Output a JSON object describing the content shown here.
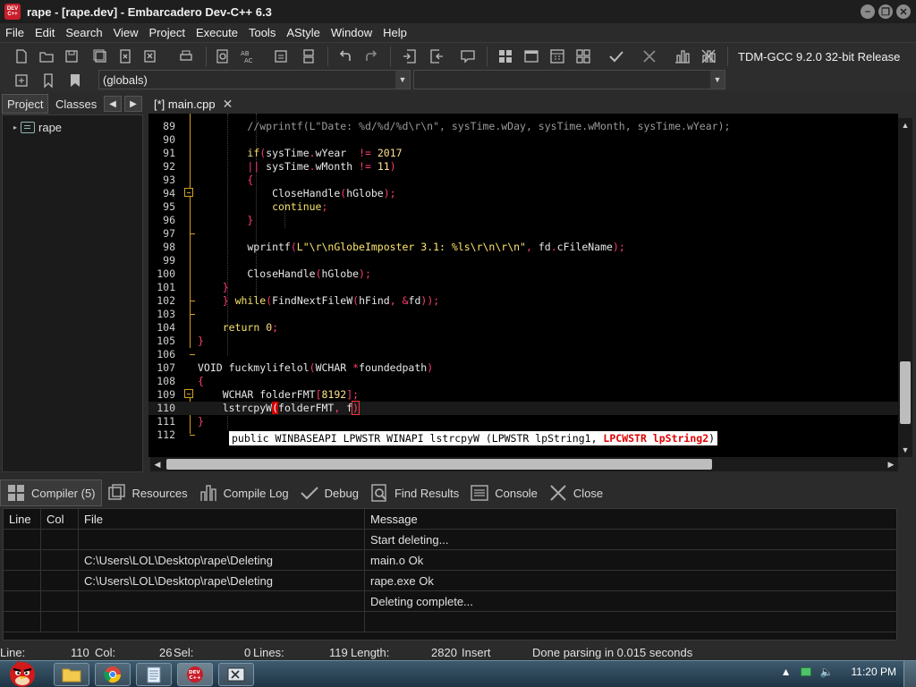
{
  "window": {
    "title": "rape - [rape.dev] - Embarcadero Dev-C++ 6.3",
    "app_icon_text": "DEV C++",
    "controls": [
      "–",
      "❐",
      "✕"
    ]
  },
  "menu": [
    "File",
    "Edit",
    "Search",
    "View",
    "Project",
    "Execute",
    "Tools",
    "AStyle",
    "Window",
    "Help"
  ],
  "toolbar": {
    "compiler": "TDM-GCC 9.2.0 32-bit Release",
    "scope_combo": "(globals)",
    "symbol_combo": ""
  },
  "left_panel": {
    "tabs": [
      "Project",
      "Classes"
    ],
    "nav_prev": "◀",
    "nav_next": "▶",
    "tree": {
      "expander": "▸",
      "project_name": "rape"
    }
  },
  "editor": {
    "tab_label": "[*] main.cpp",
    "tab_close": "✕",
    "line_numbers": [
      "89",
      "90",
      "91",
      "92",
      "93",
      "94",
      "95",
      "96",
      "97",
      "98",
      "99",
      "100",
      "101",
      "102",
      "103",
      "104",
      "105",
      "106",
      "107",
      "108",
      "109",
      "110",
      "111",
      "112"
    ],
    "tooltip": {
      "prefix": "public WINBASEAPI LPWSTR WINAPI lstrcpyW (LPWSTR lpString1, ",
      "highlight": "LPCWSTR lpString2",
      "suffix": ")"
    }
  },
  "scrollbars": {
    "up": "▲",
    "down": "▼",
    "left": "◀",
    "right": "▶"
  },
  "bottom_tabs": [
    {
      "label": "Compiler (5)",
      "icon": "compiler-grid-icon"
    },
    {
      "label": "Resources",
      "icon": "resources-icon"
    },
    {
      "label": "Compile Log",
      "icon": "chart-icon"
    },
    {
      "label": "Debug",
      "icon": "check-icon"
    },
    {
      "label": "Find Results",
      "icon": "find-icon"
    },
    {
      "label": "Console",
      "icon": "console-icon"
    },
    {
      "label": "Close",
      "icon": "close-icon"
    }
  ],
  "messages": {
    "headers": [
      "Line",
      "Col",
      "File",
      "Message"
    ],
    "rows": [
      [
        "",
        "",
        "",
        "Start deleting..."
      ],
      [
        "",
        "",
        "C:\\Users\\LOL\\Desktop\\rape\\Deleting",
        "main.o Ok"
      ],
      [
        "",
        "",
        "C:\\Users\\LOL\\Desktop\\rape\\Deleting",
        "rape.exe Ok"
      ],
      [
        "",
        "",
        "",
        "Deleting complete..."
      ],
      [
        "",
        "",
        "",
        ""
      ]
    ]
  },
  "status": {
    "line_label": "Line:",
    "line_value": "110",
    "col_label": "Col:",
    "col_value": "26",
    "sel_label": "Sel:",
    "sel_value": "0",
    "lines_label": "Lines:",
    "lines_value": "119",
    "length_label": "Length:",
    "length_value": "2820",
    "mode": "Insert",
    "message": "Done parsing in 0.015 seconds"
  },
  "taskbar": {
    "clock": "11:20 PM"
  }
}
